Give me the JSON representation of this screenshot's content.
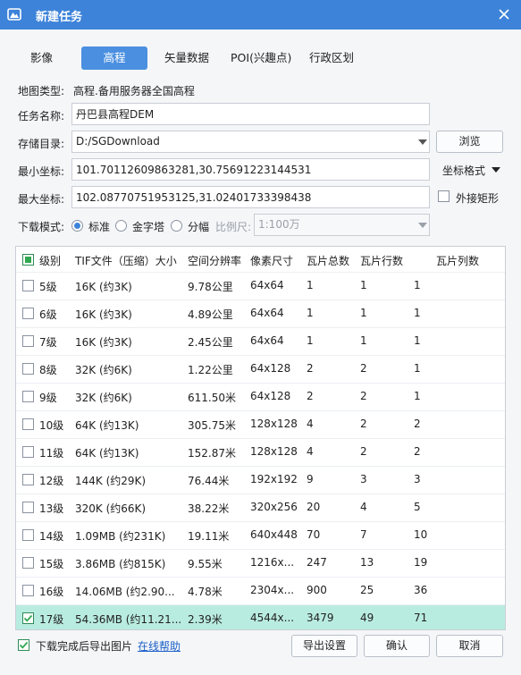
{
  "window": {
    "title": "新建任务"
  },
  "tabs": [
    "影像",
    "高程",
    "矢量数据",
    "POI(兴趣点)",
    "行政区划"
  ],
  "form": {
    "map_type_label": "地图类型:",
    "map_type_value": "高程.备用服务器全国高程",
    "task_name_label": "任务名称:",
    "task_name_value": "丹巴县高程DEM",
    "storage_label": "存储目录:",
    "storage_value": "D:/SGDownload",
    "browse_label": "浏览",
    "min_coord_label": "最小坐标:",
    "min_coord_value": "101.70112609863281,30.75691223144531",
    "coord_format_label": "坐标格式",
    "max_coord_label": "最大坐标:",
    "max_coord_value": "102.08770751953125,31.02401733398438",
    "bbox_label": "外接矩形",
    "mode_label": "下载模式:",
    "modes": [
      "标准",
      "金字塔",
      "分幅"
    ],
    "scale_label": "比例尺:",
    "scale_value": "1:100万"
  },
  "table": {
    "headers": [
      "级别",
      "TIF文件（压缩）大小",
      "空间分辨率",
      "像素尺寸",
      "瓦片总数",
      "瓦片行数",
      "瓦片列数"
    ],
    "rows": [
      [
        "5级",
        "16K (约3K)",
        "9.78公里",
        "64x64",
        "1",
        "1",
        "1"
      ],
      [
        "6级",
        "16K (约3K)",
        "4.89公里",
        "64x64",
        "1",
        "1",
        "1"
      ],
      [
        "7级",
        "16K (约3K)",
        "2.45公里",
        "64x64",
        "1",
        "1",
        "1"
      ],
      [
        "8级",
        "32K (约6K)",
        "1.22公里",
        "64x128",
        "2",
        "2",
        "1"
      ],
      [
        "9级",
        "32K (约6K)",
        "611.50米",
        "64x128",
        "2",
        "2",
        "1"
      ],
      [
        "10级",
        "64K (约13K)",
        "305.75米",
        "128x128",
        "4",
        "2",
        "2"
      ],
      [
        "11级",
        "64K (约13K)",
        "152.87米",
        "128x128",
        "4",
        "2",
        "2"
      ],
      [
        "12级",
        "144K (约29K)",
        "76.44米",
        "192x192",
        "9",
        "3",
        "3"
      ],
      [
        "13级",
        "320K (约66K)",
        "38.22米",
        "320x256",
        "20",
        "4",
        "5"
      ],
      [
        "14级",
        "1.09MB (约231K)",
        "19.11米",
        "640x448",
        "70",
        "7",
        "10"
      ],
      [
        "15级",
        "3.86MB (约815K)",
        "9.55米",
        "1216x...",
        "247",
        "13",
        "19"
      ],
      [
        "16级",
        "14.06MB (约2.90...",
        "4.78米",
        "2304x...",
        "900",
        "25",
        "36"
      ],
      [
        "17级",
        "54.36MB (约11.21...",
        "2.39米",
        "4544x...",
        "3479",
        "49",
        "71"
      ]
    ],
    "checked": [
      false,
      false,
      false,
      false,
      false,
      false,
      false,
      false,
      false,
      false,
      false,
      false,
      true
    ]
  },
  "footer": {
    "export_check_label": "下载完成后导出图片",
    "help_link": "在线帮助",
    "export_settings": "导出设置",
    "ok": "确认",
    "cancel": "取消"
  },
  "colors": {
    "titlebar": "#3d83d9",
    "selected_row": "#b9ece0",
    "accent": "#4a8fe0"
  }
}
